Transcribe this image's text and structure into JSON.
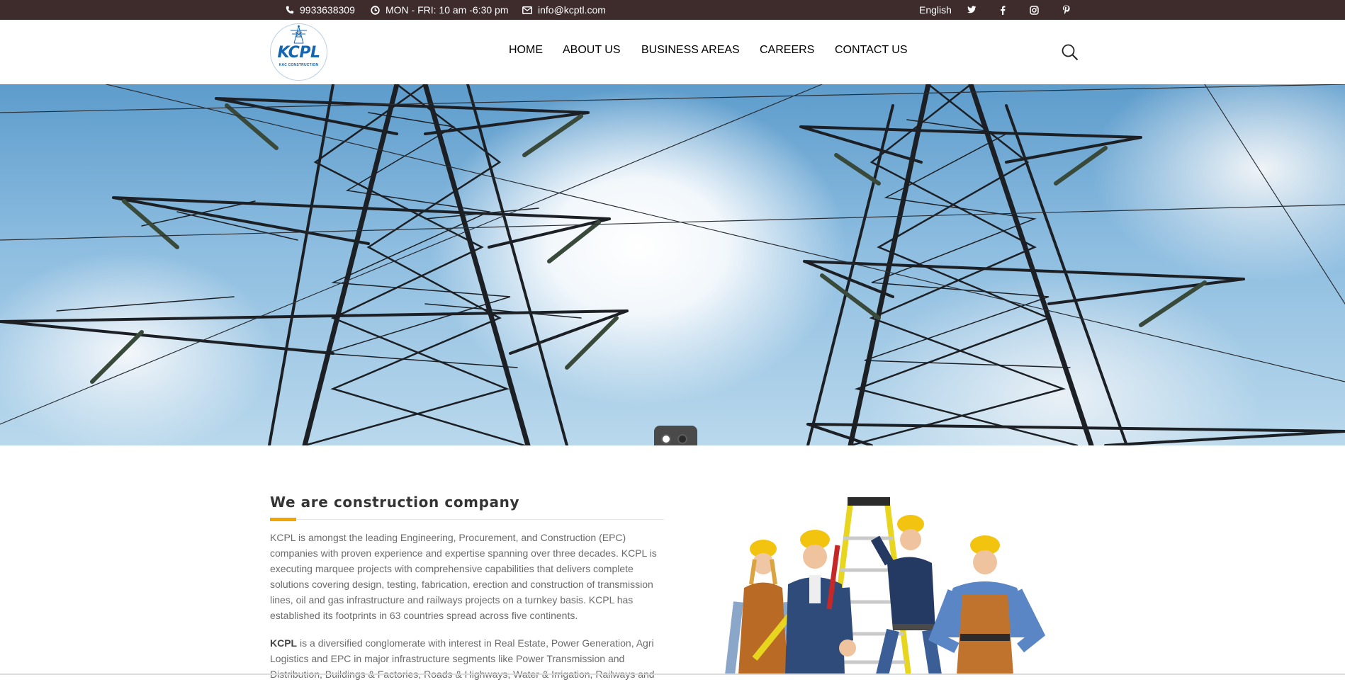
{
  "topbar": {
    "phone": "9933638309",
    "hours": "MON - FRI: 10 am -6:30 pm",
    "email": "info@kcptl.com",
    "language": "English",
    "social": [
      "twitter-icon",
      "facebook-icon",
      "instagram-icon",
      "pinterest-icon"
    ]
  },
  "logo": {
    "text": "KCPL",
    "subtitle": "KAC CONSTRUCTION"
  },
  "nav": {
    "items": [
      "HOME",
      "ABOUT US",
      "BUSINESS AREAS",
      "CAREERS",
      "CONTACT US"
    ]
  },
  "hero": {
    "slides": 2,
    "active_slide": 1
  },
  "about": {
    "title": "We are construction company",
    "paragraph1": "KCPL is amongst the leading Engineering, Procurement, and Construction (EPC) companies with proven experience and expertise spanning over three decades. KCPL is executing marquee projects with comprehensive capabilities that delivers complete solutions covering design, testing, fabrication, erection and construction of transmission lines, oil and gas infrastructure and railways projects on a turnkey basis. KCPL has established its footprints in 63 countries spread across five continents.",
    "paragraph2_bold": "KCPL",
    "paragraph2": " is a diversified conglomerate with interest in Real Estate, Power Generation, Agri Logistics and EPC in major infrastructure segments like Power Transmission and Distribution, Buildings & Factories, Roads & Highways, Water & Irrigation, Railways and"
  },
  "colors": {
    "topbar_bg": "#3e2c2c",
    "accent": "#f0a500",
    "logo_blue": "#1466b0"
  }
}
